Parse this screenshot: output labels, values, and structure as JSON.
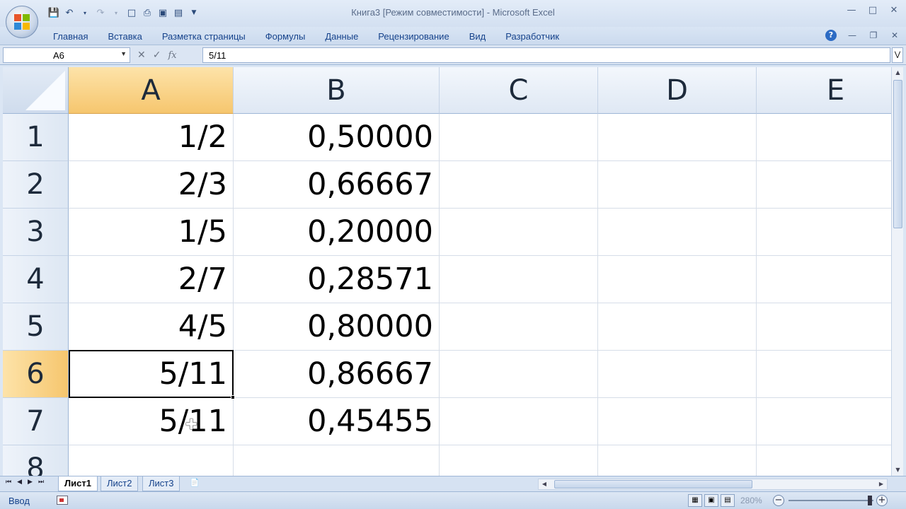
{
  "app": {
    "title": "Книга3  [Режим совместимости] - Microsoft Excel"
  },
  "quick_access": [
    "save-icon",
    "undo-icon",
    "redo-icon",
    "new-icon",
    "print-icon",
    "preview-icon",
    "form-icon",
    "customize-icon"
  ],
  "ribbon": {
    "tabs": [
      "Главная",
      "Вставка",
      "Разметка страницы",
      "Формулы",
      "Данные",
      "Рецензирование",
      "Вид",
      "Разработчик"
    ]
  },
  "formula_bar": {
    "name_box": "A6",
    "fx_label": "fx",
    "formula": "5/11"
  },
  "grid": {
    "columns": [
      "A",
      "B",
      "C",
      "D",
      "E"
    ],
    "rows": [
      "1",
      "2",
      "3",
      "4",
      "5",
      "6",
      "7",
      "8"
    ],
    "active_column": "A",
    "active_row": "6",
    "cells": {
      "A": [
        "1/2",
        "2/3",
        "1/5",
        "2/7",
        "4/5",
        "5/11",
        "5/11",
        ""
      ],
      "B": [
        "0,50000",
        "0,66667",
        "0,20000",
        "0,28571",
        "0,80000",
        "0,86667",
        "0,45455",
        ""
      ]
    }
  },
  "sheets": {
    "tabs": [
      "Лист1",
      "Лист2",
      "Лист3"
    ],
    "active": "Лист1"
  },
  "status": {
    "mode": "Ввод",
    "zoom": "280%"
  },
  "colors": {
    "accent_header": "#f6c66e",
    "ribbon_text": "#15428b"
  }
}
